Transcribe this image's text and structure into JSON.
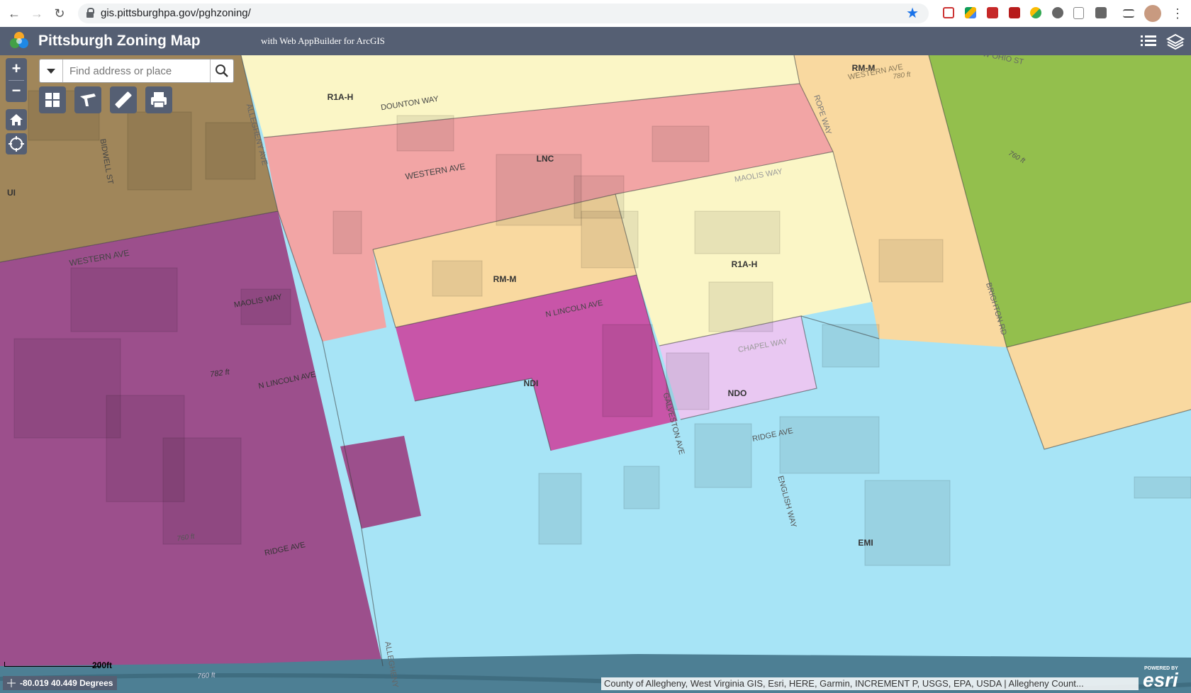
{
  "browser": {
    "url": "gis.pittsburghpa.gov/pghzoning/"
  },
  "app": {
    "title": "Pittsburgh Zoning Map",
    "subtitle": "with Web AppBuilder for ArcGIS"
  },
  "search": {
    "placeholder": "Find address or place"
  },
  "map_controls": {
    "zoom_in": "+",
    "zoom_out": "−"
  },
  "zones": [
    {
      "code": "R1A-H"
    },
    {
      "code": "LNC"
    },
    {
      "code": "RM-M"
    },
    {
      "code": "R1A-H"
    },
    {
      "code": "RM-M"
    },
    {
      "code": "UI"
    },
    {
      "code": "NDI"
    },
    {
      "code": "NDO"
    },
    {
      "code": "EMI"
    }
  ],
  "streets": [
    "DOUNTON WAY",
    "WESTERN AVE",
    "WESTERN AVE",
    "WESTERN AVE",
    "MAOLIS WAY",
    "MAOLIS WAY",
    "N LINCOLN AVE",
    "N LINCOLN AVE",
    "CHAPEL WAY",
    "RIDGE AVE",
    "RIDGE AVE",
    "GALVESTON AVE",
    "ENGLISH WAY",
    "BIDWELL ST",
    "ALLEGHENY AVE",
    "ALLEGHENY",
    "ROPE WAY",
    "BRIGHTON RD",
    "W OHIO ST"
  ],
  "elevation_labels": [
    "782 ft",
    "760 ft",
    "760 ft",
    "780 ft",
    "760 ft"
  ],
  "scale": {
    "label": "200ft"
  },
  "coordinates": "-80.019 40.449 Degrees",
  "attribution": "County of Allegheny, West Virginia GIS, Esri, HERE, Garmin, INCREMENT P, USGS, EPA, USDA | Allegheny Count...",
  "esri_logo": {
    "powered_by": "POWERED BY",
    "name": "esri"
  },
  "colors": {
    "header": "#555f73",
    "UI": "#a0865a",
    "purple_industrial": "#9c4f8c",
    "LNC": "#f2a5a5",
    "RM-M": "#f9d9a0",
    "R1A-H": "#fbf6c6",
    "NDI": "#c855a8",
    "NDO": "#e9c8f2",
    "EMI": "#a7e4f6",
    "park": "#93bf4d",
    "river": "#4d7f94"
  }
}
